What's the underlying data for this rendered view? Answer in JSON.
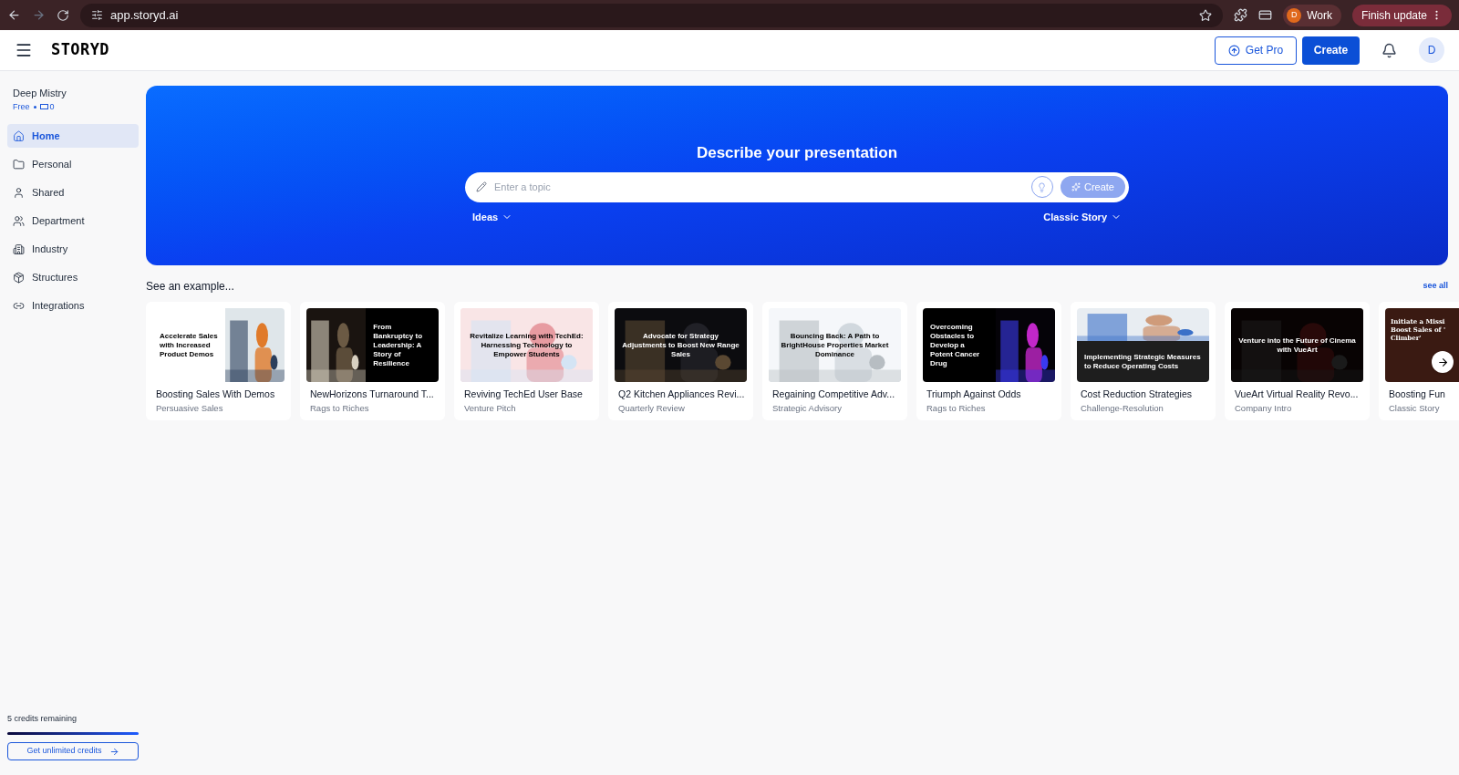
{
  "browser": {
    "url": "app.storyd.ai",
    "profile_initial": "D",
    "profile": "Work",
    "update": "Finish update"
  },
  "header": {
    "logo": "STORYD",
    "get_pro": "Get Pro",
    "create": "Create",
    "avatar": "D"
  },
  "sidebar": {
    "user": "Deep Mistry",
    "plan": "Free",
    "count": "0",
    "items": [
      {
        "label": "Home",
        "selected": true
      },
      {
        "label": "Personal",
        "selected": false
      },
      {
        "label": "Shared",
        "selected": false
      },
      {
        "label": "Department",
        "selected": false
      },
      {
        "label": "Industry",
        "selected": false
      },
      {
        "label": "Structures",
        "selected": false
      },
      {
        "label": "Integrations",
        "selected": false
      }
    ],
    "credits": {
      "label": "5 credits remaining",
      "level": 1
    },
    "cta": "Get unlimited credits"
  },
  "hero": {
    "title": "Describe your presentation",
    "placeholder": "Enter a topic",
    "create": "Create",
    "ideas": "Ideas",
    "structure": "Classic Story"
  },
  "examples": {
    "title": "See an example...",
    "see_all": "see all",
    "cards": [
      {
        "name": "Boosting Sales With Demos",
        "type": "Persuasive Sales",
        "slide": {
          "kind": "split-right-light",
          "title": "Accelerate Sales with Increased Product Demos"
        }
      },
      {
        "name": "NewHorizons Turnaround T...",
        "type": "Rags to Riches",
        "slide": {
          "kind": "split-left-dark",
          "title": "From Bankruptcy to Leadership: A Story of Resilience"
        }
      },
      {
        "name": "Reviving TechEd User Base",
        "type": "Venture Pitch",
        "slide": {
          "kind": "overlay-light",
          "title": "Revitalize Learning with TechEd: Harnessing Technology to Empower Students"
        }
      },
      {
        "name": "Q2 Kitchen Appliances Revi...",
        "type": "Quarterly Review",
        "slide": {
          "kind": "overlay-dark",
          "title": "Advocate for Strategy Adjustments to Boost New Range Sales"
        }
      },
      {
        "name": "Regaining Competitive Adv...",
        "type": "Strategic Advisory",
        "slide": {
          "kind": "overlay-light",
          "title": "Bouncing Back: A Path to BrightHouse Properties Market Dominance"
        }
      },
      {
        "name": "Triumph Against Odds",
        "type": "Rags to Riches",
        "slide": {
          "kind": "split-right-dark",
          "title": "Overcoming Obstacles to Develop a Potent Cancer Drug"
        }
      },
      {
        "name": "Cost Reduction Strategies",
        "type": "Challenge-Resolution",
        "slide": {
          "kind": "band",
          "title": "Implementing Strategic Measures to Reduce Operating Costs"
        }
      },
      {
        "name": "VueArt Virtual Reality Revo...",
        "type": "Company Intro",
        "slide": {
          "kind": "overlay-dark",
          "title": "Venture into the Future of Cinema with VueArt"
        }
      },
      {
        "name": "Boosting Fun",
        "type": "Classic Story",
        "slide": {
          "kind": "plain",
          "title": "Initiate a Missi\nBoost Sales of '\nClimber'"
        }
      }
    ]
  }
}
